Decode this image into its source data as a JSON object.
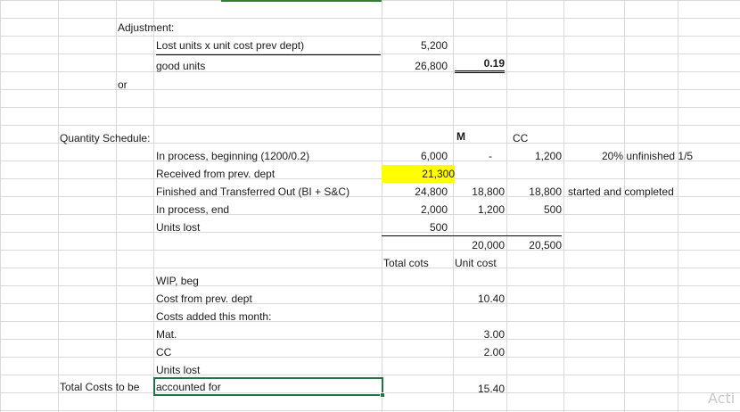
{
  "adjustment": {
    "heading": "Adjustment:",
    "numerator_label": "Lost units x unit cost prev dept)",
    "numerator_value": "5,200",
    "denominator_label": "good units",
    "denominator_value": "26,800",
    "result": "0.19",
    "or_label": "or"
  },
  "quantity": {
    "heading": "Quantity Schedule:",
    "col_m": "M",
    "col_cc": "CC",
    "rows": [
      {
        "label": "In process, beginning (1200/0.2)",
        "value": "6,000",
        "m": "-",
        "cc": "1,200",
        "note": "20% unfinished 1/5"
      },
      {
        "label": "Received from prev. dept",
        "value": "21,300",
        "m": "",
        "cc": "",
        "note": ""
      },
      {
        "label": "Finished and Transferred Out (BI + S&C)",
        "value": "24,800",
        "m": "18,800",
        "cc": "18,800",
        "note": "started and completed"
      },
      {
        "label": "In process, end",
        "value": "2,000",
        "m": "1,200",
        "cc": "500",
        "note": ""
      },
      {
        "label": "Units lost",
        "value": "500",
        "m": "",
        "cc": "",
        "note": ""
      }
    ],
    "total_m": "20,000",
    "total_cc": "20,500"
  },
  "costs": {
    "total_cost_header": "Total cots",
    "unit_cost_header": "Unit cost",
    "rows": [
      {
        "label": "WIP, beg",
        "unit": ""
      },
      {
        "label": "Cost from prev. dept",
        "unit": "10.40"
      },
      {
        "label": "Costs added this month:",
        "unit": ""
      },
      {
        "label": "Mat.",
        "unit": "3.00"
      },
      {
        "label": "CC",
        "unit": "2.00"
      },
      {
        "label": "Units lost",
        "unit": ""
      }
    ],
    "total_label_a": "Total Costs to be",
    "total_label_b": "accounted for",
    "total_unit": "15.40"
  },
  "watermark": "Acti"
}
